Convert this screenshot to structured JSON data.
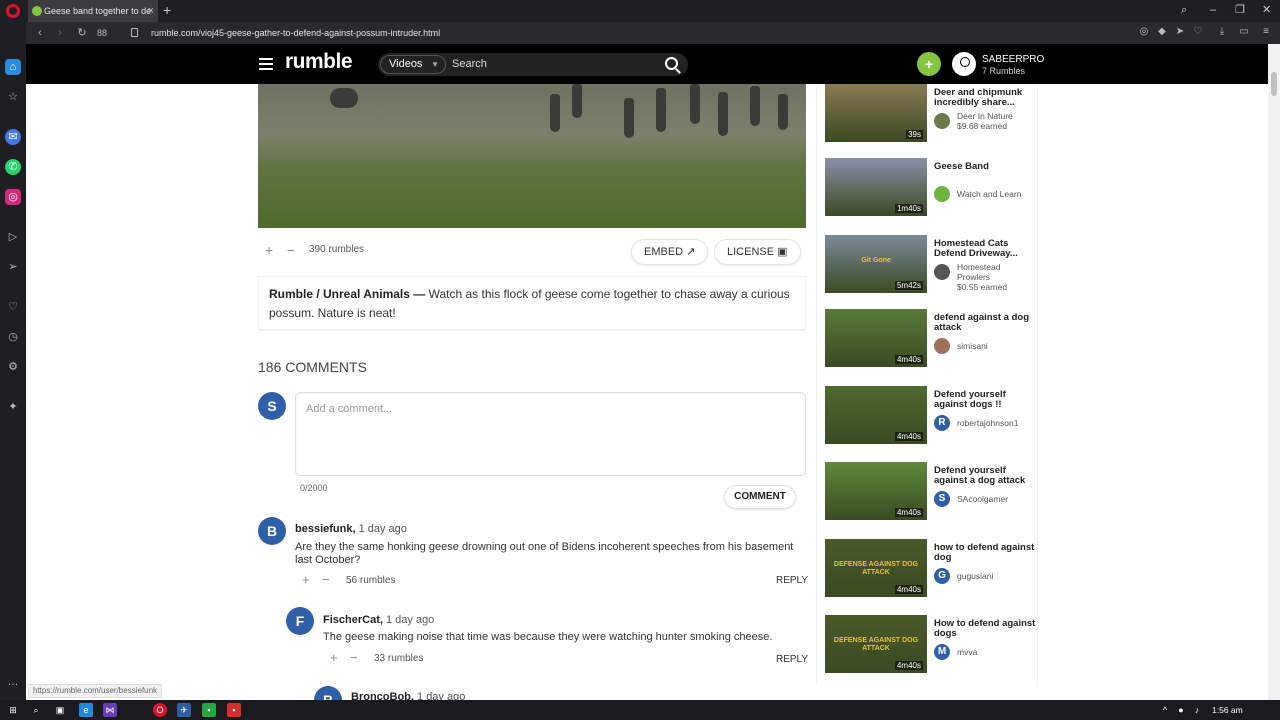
{
  "browser": {
    "tab_title": "Geese band together to de",
    "url": "rumble.com/vioj45-geese-gather-to-defend-against-possum-intruder.html",
    "speed_dial_label": "88",
    "status_bar_url": "https://rumble.com/user/bessiefunk"
  },
  "header": {
    "logo": "rumble",
    "category": "Videos",
    "search_placeholder": "Search",
    "username": "SABEERPRO",
    "user_rumbles": "7 Rumbles"
  },
  "video_actions": {
    "rumbles": "390 rumbles",
    "embed_label": "EMBED",
    "license_label": "LICENSE"
  },
  "description": {
    "channel": "Rumble / Unreal Animals —",
    "text": "Watch as this flock of geese come together to chase away a curious possum. Nature is neat!"
  },
  "comments": {
    "title": "186 COMMENTS",
    "my_initial": "S",
    "placeholder": "Add a comment...",
    "char_count": "0/2000",
    "submit_label": "COMMENT",
    "items": [
      {
        "initial": "B",
        "user": "bessiefunk,",
        "time": "1 day ago",
        "text": "Are they the same honking geese drowning out one of Bidens incoherent speeches from his basement last October?",
        "rumbles": "56 rumbles",
        "reply": "REPLY"
      },
      {
        "initial": "F",
        "user": "FischerCat,",
        "time": "1 day ago",
        "text": "The geese making noise that time was because they were watching hunter smoking cheese.",
        "rumbles": "33 rumbles",
        "reply": "REPLY"
      },
      {
        "initial": "B",
        "user": "BroncoBob,",
        "time": "1 day ago"
      }
    ]
  },
  "recommendations": [
    {
      "title": "Deer and chipmunk incredibly share...",
      "duration": "39s",
      "channel": "Deer In Nature",
      "earned": "$9.68 earned",
      "avatar_color": "#6b7b4b",
      "thumb_color": "#8a7a55"
    },
    {
      "title": "Geese Band",
      "duration": "1m40s",
      "channel": "Watch and Learn",
      "earned": "",
      "avatar_color": "#6db33f",
      "thumb_color": "#8b90a8"
    },
    {
      "title": "Homestead Cats Defend Driveway...",
      "duration": "5m42s",
      "channel": "Homestead Prowlers",
      "earned": "$0.55 earned",
      "avatar_color": "#555555",
      "thumb_color": "#7b8a9a",
      "thumb_text": "Git Gone"
    },
    {
      "title": "defend against a dog attack",
      "duration": "4m40s",
      "channel": "simisani",
      "earned": "",
      "avatar_color": "#a0705a",
      "thumb_color": "#5a7a3a"
    },
    {
      "title": "Defend yourself against dogs !!",
      "duration": "4m40s",
      "channel": "robertajohnson1",
      "earned": "",
      "avatar_color": "#2f5fa7",
      "avatar_letter": "R",
      "thumb_color": "#4f6a30"
    },
    {
      "title": "Defend yourself against a dog attack",
      "duration": "4m40s",
      "channel": "SAcoolgamer",
      "earned": "",
      "avatar_color": "#2f5fa7",
      "avatar_letter": "S",
      "thumb_color": "#5f8a3a"
    },
    {
      "title": "how to defend against dog",
      "duration": "4m40s",
      "channel": "gugusiani",
      "earned": "",
      "avatar_color": "#2f5fa7",
      "avatar_letter": "G",
      "thumb_color": "#4a5a2a",
      "thumb_text": "DEFENSE AGAINST DOG ATTACK"
    },
    {
      "title": "How to defend against dogs",
      "duration": "4m40s",
      "channel": "mvva",
      "earned": "",
      "avatar_color": "#2f5fa7",
      "avatar_letter": "M",
      "thumb_color": "#4a5a2a",
      "thumb_text": "DEFENSE AGAINST DOG ATTACK"
    }
  ],
  "taskbar": {
    "time": "1:56 am"
  },
  "colors": {
    "brand_green": "#85c742",
    "avatar_blue": "#2f5fa7",
    "header_bg": "#000000"
  }
}
